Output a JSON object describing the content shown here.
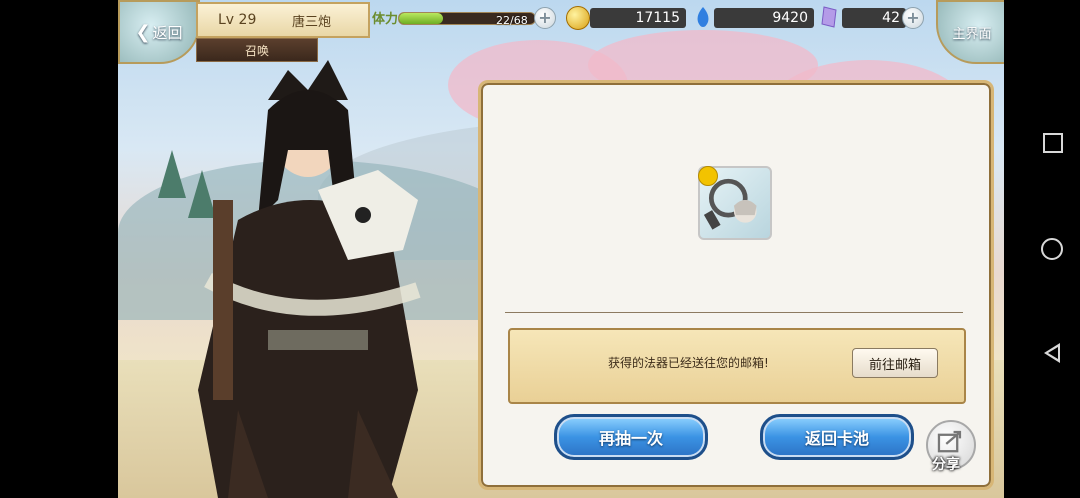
{
  "header": {
    "back_label": "返回",
    "level": "Lv 29",
    "player_name": "唐三炮",
    "tab_label": "召唤",
    "home_label": "主界面"
  },
  "resources": {
    "stamina_label": "体力",
    "stamina_text": "22/68",
    "stamina_fraction": 0.3235,
    "gold": "17115",
    "soul": "9420",
    "crystal": "42"
  },
  "dialog": {
    "message": "获得的法器已经送往您的邮箱!",
    "mailbox_button": "前往邮箱",
    "draw_again_button": "再抽一次",
    "return_pool_button": "返回卡池",
    "share_label": "分享"
  },
  "colors": {
    "button_blue": "#3b93e4",
    "frame_gold": "#d7b676",
    "scroll_tan": "#e9d096"
  },
  "icons": {
    "back": "back-arrow-icon",
    "gold": "gold-coin-icon",
    "soul": "blue-flame-icon",
    "crystal": "purple-crystal-icon",
    "share": "share-icon",
    "nav_recents": "square-icon",
    "nav_home": "circle-icon",
    "nav_back": "triangle-back-icon"
  }
}
